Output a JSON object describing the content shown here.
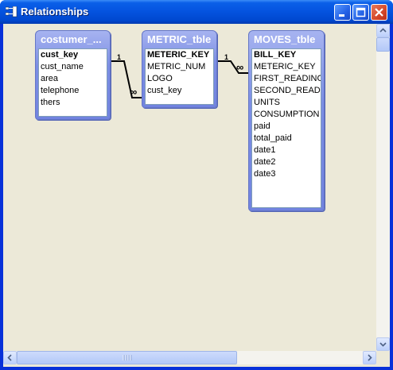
{
  "window": {
    "title": "Relationships"
  },
  "tables": [
    {
      "title": "costumer_...",
      "fields": [
        {
          "name": "cust_key",
          "pk": true
        },
        {
          "name": "cust_name",
          "pk": false
        },
        {
          "name": "area",
          "pk": false
        },
        {
          "name": "telephone",
          "pk": false
        },
        {
          "name": "thers",
          "pk": false
        }
      ]
    },
    {
      "title": "METRIC_tble",
      "fields": [
        {
          "name": "METERIC_KEY",
          "pk": true
        },
        {
          "name": "METRIC_NUM",
          "pk": false
        },
        {
          "name": "LOGO",
          "pk": false
        },
        {
          "name": "cust_key",
          "pk": false
        }
      ]
    },
    {
      "title": "MOVES_tble",
      "fields": [
        {
          "name": "BILL_KEY",
          "pk": true
        },
        {
          "name": "METERIC_KEY",
          "pk": false
        },
        {
          "name": "FIRST_READING",
          "pk": false
        },
        {
          "name": "SECOND_READING",
          "pk": false
        },
        {
          "name": "UNITS",
          "pk": false
        },
        {
          "name": "CONSUMPTION",
          "pk": false
        },
        {
          "name": "paid",
          "pk": false
        },
        {
          "name": "total_paid",
          "pk": false
        },
        {
          "name": "date1",
          "pk": false
        },
        {
          "name": "date2",
          "pk": false
        },
        {
          "name": "date3",
          "pk": false
        }
      ]
    }
  ],
  "relationships": [
    {
      "one_label": "1",
      "many_label": "∞"
    },
    {
      "one_label": "1",
      "many_label": "∞"
    }
  ],
  "colors": {
    "titlebar": "#0054e3",
    "table_header": "#7b8de3",
    "client_bg": "#ece9d8"
  }
}
